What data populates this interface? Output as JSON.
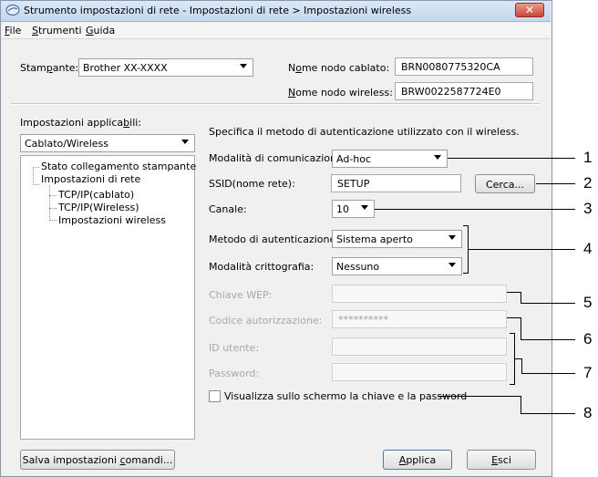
{
  "window": {
    "title": "Strumento impostazioni di rete - Impostazioni di rete > Impostazioni wireless",
    "close_glyph": "✕"
  },
  "menu": {
    "file_key": "F",
    "file_rest": "ile",
    "strumenti_key": "S",
    "strumenti_rest": "trumenti",
    "guida_key": "G",
    "guida_rest": "uida"
  },
  "header": {
    "printer_label_pre": "Stam",
    "printer_label_key": "p",
    "printer_label_post": "ante:",
    "printer_value": "Brother XX-XXXX",
    "wired_node_label_pre": "N",
    "wired_node_label_key": "o",
    "wired_node_label_post": "me nodo cablato:",
    "wired_node_value": "BRN0080775320CA",
    "wireless_node_label_key": "N",
    "wireless_node_label_post": "ome nodo wireless:",
    "wireless_node_value": "BRW0022587724E0"
  },
  "left_panel": {
    "settings_label_pre": "Impostazioni applica",
    "settings_label_key": "b",
    "settings_label_post": "ili:",
    "settings_combo": "Cablato/Wireless",
    "tree": [
      "Stato collegamento stampante",
      "Impostazioni di rete",
      "TCP/IP(cablato)",
      "TCP/IP(Wireless)",
      "Impostazioni wireless"
    ]
  },
  "form": {
    "intro": "Specifica il metodo di autenticazione utilizzato con il wireless.",
    "comm_mode_label": "Modalità di comunicazione:",
    "comm_mode_value": "Ad-hoc",
    "ssid_label": "SSID(nome rete):",
    "ssid_value": "SETUP",
    "search_button": "Cerca...",
    "channel_label": "Canale:",
    "channel_value": "10",
    "auth_label": "Metodo di autenticazione:",
    "auth_value": "Sistema aperto",
    "encryption_label": "Modalità crittografia:",
    "encryption_value": "Nessuno",
    "wep_label": "Chiave WEP:",
    "wep_value": "",
    "auth_code_label": "Codice autorizzazione:",
    "auth_code_value": "**********",
    "user_id_label": "ID utente:",
    "user_id_value": "",
    "password_label": "Password:",
    "password_value": "",
    "show_keys_checkbox": "Visualizza sullo schermo la chiave e la password"
  },
  "footer": {
    "save_pre": "Salva impostazioni ",
    "save_key": "c",
    "save_post": "omandi...",
    "apply_key": "A",
    "apply_post": "pplica",
    "exit_key": "E",
    "exit_post": "sci"
  },
  "callouts": [
    "1",
    "2",
    "3",
    "4",
    "5",
    "6",
    "7",
    "8"
  ]
}
